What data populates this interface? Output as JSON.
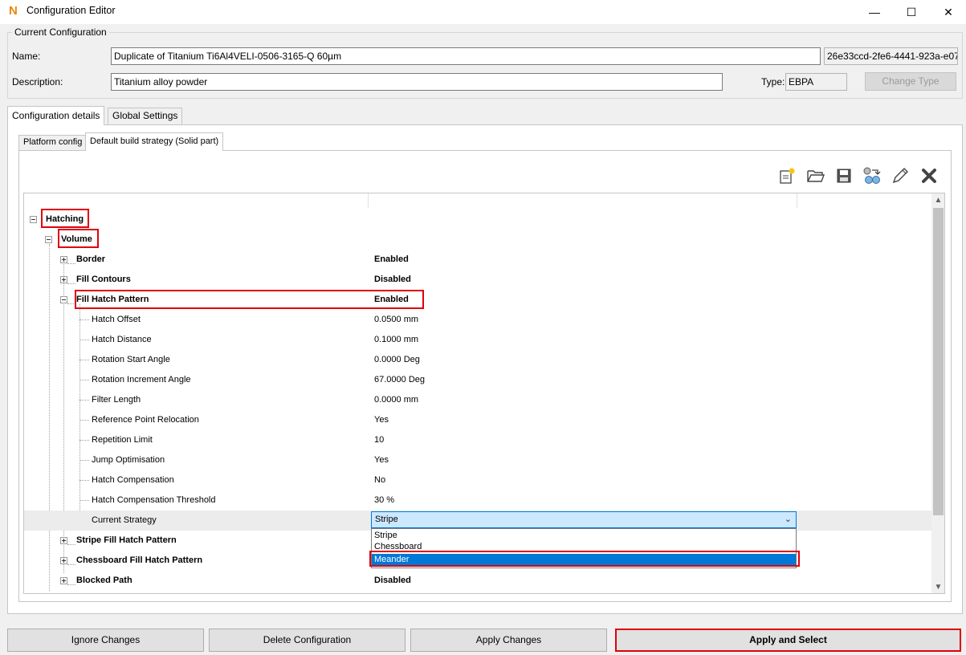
{
  "window": {
    "title": "Configuration Editor",
    "logo": "N",
    "minimize": "—",
    "maximize": "☐",
    "close": "✕"
  },
  "group_title": "Current Configuration",
  "name_label": "Name:",
  "name_value": "Duplicate of Titanium Ti6Al4VELI-0506-3165-Q 60µm",
  "guid_value": "26e33ccd-2fe6-4441-923a-e07c",
  "description_label": "Description:",
  "description_value": "Titanium alloy powder",
  "type_label": "Type:",
  "type_value": "EBPA",
  "change_type_button": "Change Type",
  "tabs": {
    "config_details": "Configuration details",
    "global_settings": "Global Settings"
  },
  "subtabs": {
    "platform_config": "Platform config",
    "default_strategy": "Default build strategy (Solid part)"
  },
  "toolbar_icons": [
    "new-file-icon",
    "open-folder-icon",
    "save-icon",
    "export-icon",
    "edit-pencil-icon",
    "delete-x-icon"
  ],
  "tree": {
    "hatching": "Hatching",
    "volume": "Volume",
    "rows": [
      {
        "label": "Border",
        "value": "Enabled",
        "bold": true
      },
      {
        "label": "Fill Contours",
        "value": "Disabled",
        "bold": true
      },
      {
        "label": "Fill Hatch Pattern",
        "value": "Enabled",
        "bold": true
      },
      {
        "label": "Hatch Offset",
        "value": "0.0500 mm"
      },
      {
        "label": "Hatch Distance",
        "value": "0.1000 mm"
      },
      {
        "label": "Rotation Start Angle",
        "value": "0.0000 Deg"
      },
      {
        "label": "Rotation Increment Angle",
        "value": "67.0000 Deg"
      },
      {
        "label": "Filter Length",
        "value": "0.0000 mm"
      },
      {
        "label": "Reference Point Relocation",
        "value": "Yes"
      },
      {
        "label": "Repetition Limit",
        "value": "10"
      },
      {
        "label": "Jump Optimisation",
        "value": "Yes"
      },
      {
        "label": "Hatch Compensation",
        "value": "No"
      },
      {
        "label": "Hatch Compensation Threshold",
        "value": "30 %"
      },
      {
        "label": "Current Strategy",
        "value": "Stripe"
      },
      {
        "label": "Stripe Fill Hatch Pattern",
        "value": ""
      },
      {
        "label": "Chessboard Fill Hatch Pattern",
        "value": ""
      },
      {
        "label": "Blocked Path",
        "value": "Disabled"
      }
    ]
  },
  "strategy_dropdown": {
    "selected": "Stripe",
    "options": [
      "Stripe",
      "Chessboard",
      "Meander"
    ],
    "highlighted": "Meander"
  },
  "buttons": {
    "ignore": "Ignore Changes",
    "delete": "Delete Configuration",
    "apply": "Apply Changes",
    "apply_select": "Apply and Select"
  }
}
